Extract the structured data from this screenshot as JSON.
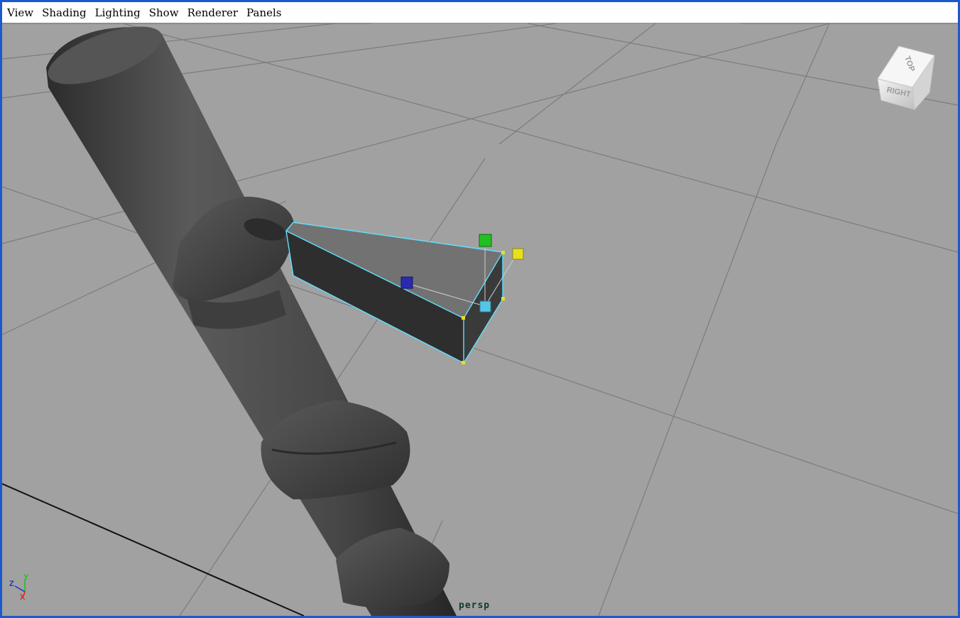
{
  "menubar": {
    "items": [
      "View",
      "Shading",
      "Lighting",
      "Show",
      "Renderer",
      "Panels"
    ]
  },
  "viewport": {
    "camera_label": "persp",
    "background_color": "#a1a1a1",
    "grid_color": "#7a7a7a",
    "selection_wire_color": "#5fe0ff"
  },
  "view_cube": {
    "top_label": "TOP",
    "right_label": "RIGHT"
  },
  "axis_indicator": {
    "x_label": "X",
    "y_label": "Y",
    "z_label": "Z",
    "x_color": "#e02020",
    "y_color": "#20c020",
    "z_color": "#2030d0"
  },
  "manipulator": {
    "x_handle_color": "#e6e020",
    "y_handle_color": "#22c022",
    "z_handle_color": "#2a2ab0",
    "center_handle_color": "#55c6e6"
  }
}
